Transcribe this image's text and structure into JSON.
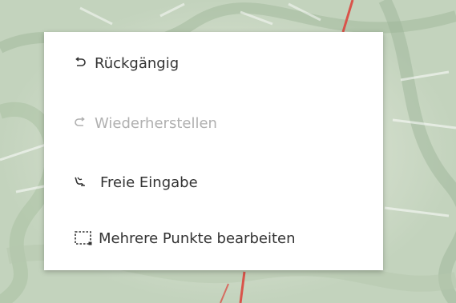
{
  "map": {
    "background_color": "#c8d6c4",
    "route_color": "#d9534a"
  },
  "context_menu": {
    "items": [
      {
        "label": "Rückgängig",
        "icon": "undo-icon",
        "enabled": true
      },
      {
        "label": "Wiederherstellen",
        "icon": "redo-icon",
        "enabled": false
      },
      {
        "label": "Freie Eingabe",
        "icon": "freehand-route-icon",
        "enabled": true
      },
      {
        "label": "Mehrere Punkte bearbeiten",
        "icon": "select-area-icon",
        "enabled": true
      }
    ]
  }
}
